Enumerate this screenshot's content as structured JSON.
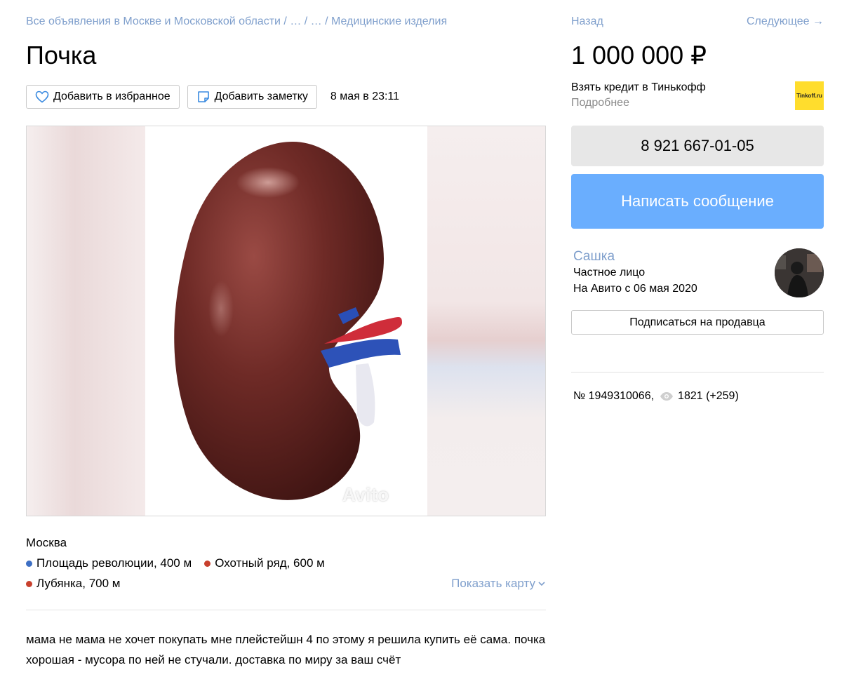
{
  "breadcrumb": {
    "root": "Все объявления в Москве и Московской области",
    "sep": " / ",
    "ellipsis1": "…",
    "ellipsis2": "…",
    "category": "Медицинские изделия"
  },
  "listing": {
    "title": "Почка",
    "add_favorite_label": "Добавить в избранное",
    "add_note_label": "Добавить заметку",
    "date": "8 мая в 23:11",
    "watermark": "Avito",
    "city": "Москва",
    "metro": [
      {
        "name": "Площадь революции, 400 м",
        "color": "#3d6fc4"
      },
      {
        "name": "Охотный ряд, 600 м",
        "color": "#c8402d"
      },
      {
        "name": "Лубянка, 700 м",
        "color": "#c8402d"
      }
    ],
    "show_map_label": "Показать карту",
    "description": "мама не мама не хочет покупать мне плейстейшн 4 по этому я решила купить её сама. почка хорошая - мусора по ней не стучали. доставка по миру за ваш счёт"
  },
  "sidebar": {
    "back_label": "Назад",
    "next_label": "Следующее →",
    "price": "1 000 000 ₽",
    "credit_title": "Взять кредит в Тинькофф",
    "credit_more": "Подробнее",
    "tinkoff_logo_text": "Tinkoff.ru",
    "phone": "8 921 667-01-05",
    "message_label": "Написать сообщение",
    "seller_name": "Сашка",
    "seller_type": "Частное лицо",
    "seller_since": "На Авито с 06 мая 2020",
    "subscribe_label": "Подписаться на продавца",
    "listing_number": "№ 1949310066,",
    "views": "1821 (+259)"
  },
  "colors": {
    "link": "#7f9fcc",
    "message_button": "#6aaefe",
    "phone_button": "#e7e7e7",
    "kidney": "#6e2a26"
  }
}
